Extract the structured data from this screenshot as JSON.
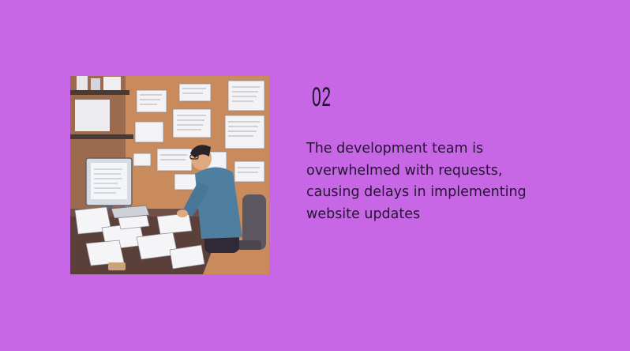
{
  "slide": {
    "background_color": "#c767e5",
    "number": "02",
    "caption": "The development team is overwhelmed with requests, causing delays in implementing website updates"
  },
  "illustration": {
    "subject": "developer-at-desk-with-papers"
  }
}
